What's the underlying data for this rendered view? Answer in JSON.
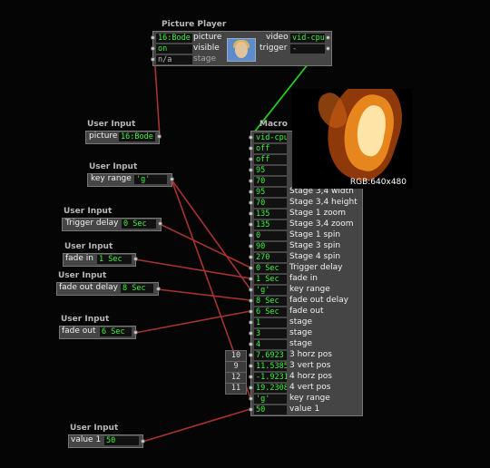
{
  "picture_player": {
    "title": "Picture Player",
    "inputs": [
      {
        "value": "16:Bode",
        "label": "picture"
      },
      {
        "value": "on",
        "label": "visible"
      },
      {
        "value": "n/a",
        "label": "stage"
      }
    ],
    "outputs": [
      {
        "label": "video",
        "value": "vid-cpu"
      },
      {
        "label": "trigger",
        "value": "-"
      }
    ]
  },
  "user_inputs": [
    {
      "title": "User Input",
      "label": "picture",
      "value": "16:Bode"
    },
    {
      "title": "User Input",
      "label": "key range",
      "value": "'g'"
    },
    {
      "title": "User Input",
      "label": "Trigger delay",
      "value": "0 Sec"
    },
    {
      "title": "User Input",
      "label": "fade in",
      "value": "1 Sec"
    },
    {
      "title": "User Input",
      "label": "fade out delay",
      "value": "8 Sec"
    },
    {
      "title": "User Input",
      "label": "fade out",
      "value": "6 Sec"
    },
    {
      "title": "User Input",
      "label": "value 1",
      "value": "50"
    }
  ],
  "macro": {
    "title": "Macro",
    "preview_label": "RGB:640x480",
    "rows": [
      {
        "value": "vid-cpu",
        "label": ""
      },
      {
        "value": "off",
        "label": ""
      },
      {
        "value": "off",
        "label": ""
      },
      {
        "value": "95",
        "label": ""
      },
      {
        "value": "70",
        "label": ""
      },
      {
        "value": "95",
        "label": "Stage 3,4 width"
      },
      {
        "value": "70",
        "label": "Stage 3,4 height"
      },
      {
        "value": "135",
        "label": "Stage 1 zoom"
      },
      {
        "value": "135",
        "label": "Stage 3,4 zoom"
      },
      {
        "value": "0",
        "label": "Stage 1 spin"
      },
      {
        "value": "90",
        "label": "Stage 3 spin"
      },
      {
        "value": "270",
        "label": "Stage 4 spin"
      },
      {
        "value": "0 Sec",
        "label": "Trigger delay"
      },
      {
        "value": "1 Sec",
        "label": "fade in"
      },
      {
        "value": "'g'",
        "label": "key range"
      },
      {
        "value": "8 Sec",
        "label": "fade out delay"
      },
      {
        "value": "6 Sec",
        "label": "fade out"
      },
      {
        "value": "1",
        "label": "stage"
      },
      {
        "value": "3",
        "label": "stage"
      },
      {
        "value": "4",
        "label": "stage"
      },
      {
        "value": "7.6923",
        "label": "3 horz pos"
      },
      {
        "value": "11.5385",
        "label": "3 vert pos"
      },
      {
        "value": "-1.9231",
        "label": "4 horz pos"
      },
      {
        "value": "19.2308",
        "label": "4 vert pos"
      },
      {
        "value": "'g'",
        "label": "key range"
      },
      {
        "value": "50",
        "label": "value 1"
      }
    ],
    "pins": [
      "10",
      "9",
      "12",
      "11"
    ]
  },
  "colors": {
    "background": "#050505",
    "node": "#454545",
    "value_text": "#3df23d",
    "wire_red": "#a83232",
    "wire_green": "#22cc22"
  }
}
